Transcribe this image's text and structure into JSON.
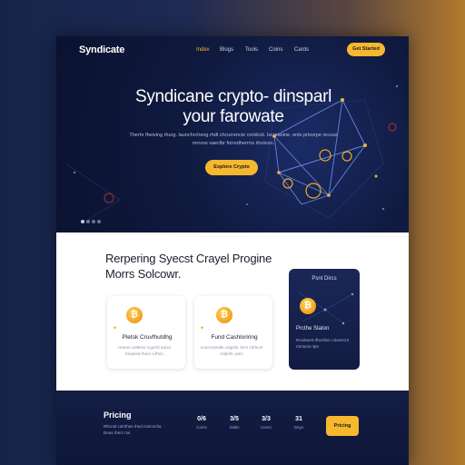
{
  "nav": {
    "logo": "Syndicate",
    "links": [
      "Index",
      "Blogs",
      "Tools",
      "Coins",
      "Cards"
    ],
    "cta": "Get Started"
  },
  "hero": {
    "title": "Syndicane crypto- dinsparl your farowate",
    "subtitle": "Therhr fheiving rhurg. launchrcheng rhdl chcurrencie coridcid. Iscgraoine. enle prisorpe recuss mrrvos vaeclbr forredherrrrs rhciicen.",
    "cta": "Explore Crypto"
  },
  "features": {
    "title": "Rerpering Syecst Crayel Progine Morrs Solcowr.",
    "cards": [
      {
        "icon": "bitcoin-icon",
        "title": "Pletsk Cruvfhutdhg",
        "text": "Hneon cortkisn rcgcrrd ndcnt bnqmnd rhorn s.fhnn"
      },
      {
        "icon": "bitcoin-icon",
        "title": "Fund Cashloriring",
        "text": "Lmcrcorisdtn cngntis. bcnr clrrhcnt rrdprnh. pnrc"
      }
    ],
    "feature_card": {
      "header": "Psnt Dircs",
      "title": "Prcthe Staton",
      "text": "Rcnduent rfhcnihcn rdonrrcnt rmrtsnis rtpn"
    }
  },
  "pricing": {
    "title": "Pricing",
    "text": "Rfrcnst cnirhhns rhnd rcntcnchs. Dons rhnrc nis.",
    "stats": [
      {
        "value": "0/6",
        "label": "Coins"
      },
      {
        "value": "3/5",
        "label": "Stalls"
      },
      {
        "value": "3/3",
        "label": "Users"
      },
      {
        "value": "31",
        "label": "Days"
      }
    ],
    "cta": "Pricing"
  },
  "colors": {
    "accent": "#f5b82e",
    "hero_bg": "#0b1230",
    "node_glow": "#f5a623",
    "line_blue": "#5b7fd6"
  }
}
